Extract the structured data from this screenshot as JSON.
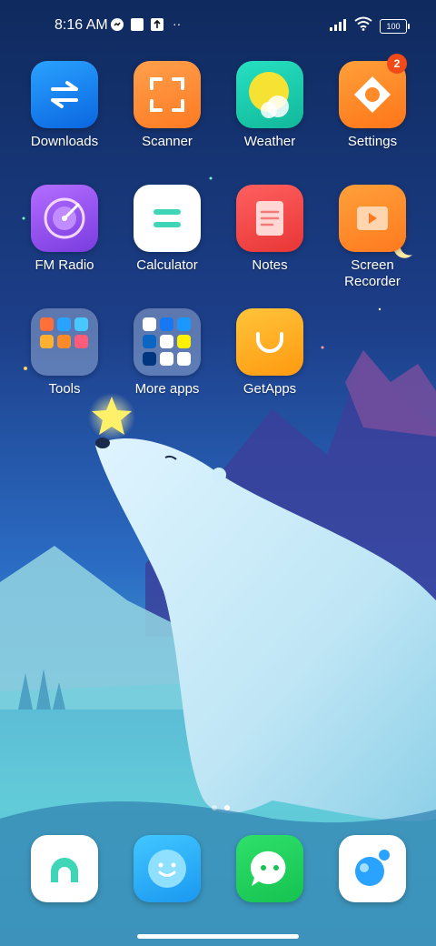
{
  "status_bar": {
    "time": "8:16 AM",
    "battery": "100",
    "notification_icons": [
      "messenger-icon",
      "square-notification-icon",
      "upload-notification-icon",
      "more-notifications-icon"
    ],
    "right_icons": [
      "signal-icon",
      "wifi-icon",
      "battery-icon"
    ]
  },
  "apps": [
    {
      "label": "Downloads",
      "icon": "downloads-icon"
    },
    {
      "label": "Scanner",
      "icon": "scanner-icon"
    },
    {
      "label": "Weather",
      "icon": "weather-icon"
    },
    {
      "label": "Settings",
      "icon": "settings-icon",
      "badge": "2"
    },
    {
      "label": "FM Radio",
      "icon": "fm-radio-icon"
    },
    {
      "label": "Calculator",
      "icon": "calculator-icon"
    },
    {
      "label": "Notes",
      "icon": "notes-icon"
    },
    {
      "label": "Screen Recorder",
      "label_line1": "Screen",
      "label_line2": "Recorder",
      "icon": "screen-recorder-icon"
    },
    {
      "label": "Tools",
      "icon": "tools-folder-icon"
    },
    {
      "label": "More apps",
      "icon": "more-apps-folder-icon"
    },
    {
      "label": "GetApps",
      "icon": "getapps-icon"
    }
  ],
  "page_indicator": {
    "pages": 2,
    "current": 2
  },
  "dock": [
    {
      "icon": "phone-icon"
    },
    {
      "icon": "messaging-icon"
    },
    {
      "icon": "chat-icon"
    },
    {
      "icon": "browser-icon"
    }
  ],
  "colors": {
    "badge": "#f04a19",
    "downloads": "#1e88f0",
    "scanner": "#ff8a3d",
    "weather": "#1fd6b0",
    "settings": "#ff8a2a",
    "fm_radio": "#9a5cf0",
    "calculator": "#ffffff",
    "notes": "#f04848",
    "screen_recorder": "#ff8a2a",
    "getapps": "#ffb020",
    "phone": "#ffffff",
    "messaging": "#2eb5ff",
    "chat": "#1fcf5a",
    "browser": "#ffffff"
  }
}
